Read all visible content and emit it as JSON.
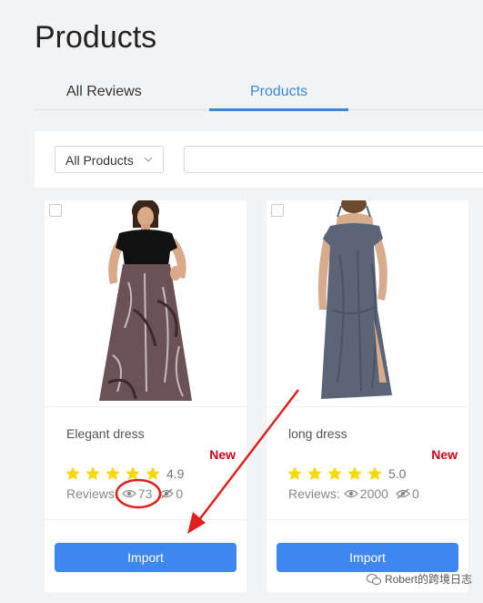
{
  "page": {
    "title": "Products"
  },
  "tabs": [
    {
      "label": "All Reviews",
      "active": false
    },
    {
      "label": "Products",
      "active": true
    }
  ],
  "filters": {
    "product_select": {
      "value": "All Products"
    },
    "search": {
      "placeholder": "",
      "value": ""
    }
  },
  "products": [
    {
      "name": "Elegant dress",
      "badge": "New",
      "rating": "4.9",
      "stars": 5,
      "reviews_label": "Reviews:",
      "visible_count": "73",
      "hidden_count": "0",
      "import_label": "Import",
      "image_icon": "dress-photo-black-floral"
    },
    {
      "name": "long dress",
      "badge": "New",
      "rating": "5.0",
      "stars": 5,
      "reviews_label": "Reviews:",
      "visible_count": "2000",
      "hidden_count": "0",
      "import_label": "Import",
      "image_icon": "dress-photo-grey-long"
    }
  ],
  "watermark": {
    "text": "Robert的跨境日志",
    "icon": "wechat-icon"
  },
  "colors": {
    "accent": "#3a86d8",
    "button": "#3e86f0",
    "badge": "#d0021b",
    "star": "#f5d90a",
    "annotation": "#e02020"
  }
}
